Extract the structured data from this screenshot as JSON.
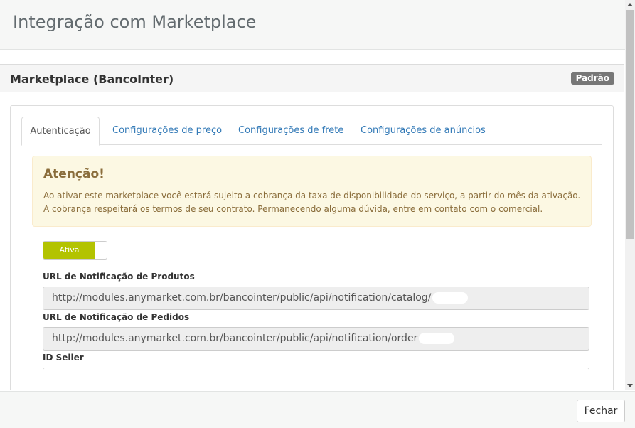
{
  "header": {
    "title": "Integração com Marketplace"
  },
  "panel": {
    "title": "Marketplace (BancoInter)",
    "badge": "Padrão"
  },
  "tabs": [
    {
      "label": "Autenticação",
      "active": true
    },
    {
      "label": "Configurações de preço",
      "active": false
    },
    {
      "label": "Configurações de frete",
      "active": false
    },
    {
      "label": "Configurações de anúncios",
      "active": false
    }
  ],
  "alert": {
    "title": "Atenção!",
    "line1": "Ao ativar este marketplace você estará sujeito a cobrança da taxa de disponibilidade do serviço, a partir do mês da ativação.",
    "line2": "A cobrança respeitará os termos de seu contrato. Permanecendo alguma dúvida, entre em contato com o comercial."
  },
  "toggle": {
    "label": "Ativa",
    "state": "on",
    "color": "#b3c301"
  },
  "form": {
    "products_url_label": "URL de Notificação de Produtos",
    "products_url_value": "http://modules.anymarket.com.br/bancointer/public/api/notification/catalog/",
    "orders_url_label": "URL de Notificação de Pedidos",
    "orders_url_value": "http://modules.anymarket.com.br/bancointer/public/api/notification/order",
    "seller_id_label": "ID Seller",
    "seller_id_value": ""
  },
  "footer": {
    "close_label": "Fechar"
  }
}
